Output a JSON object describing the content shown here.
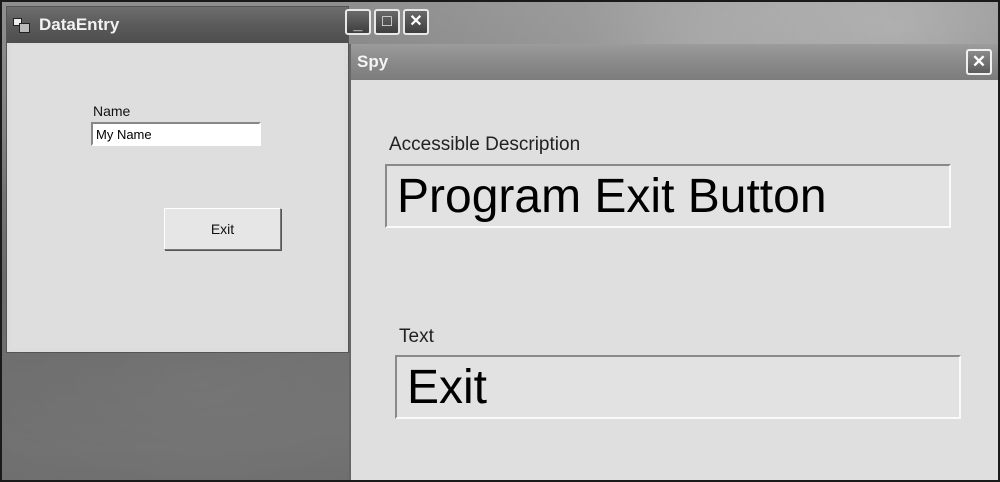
{
  "desktop": {},
  "dataentry_window": {
    "title": "DataEntry",
    "controls": {
      "minimize": "_",
      "maximize": "□",
      "close": "✕"
    },
    "name_label": "Name",
    "name_value": "My Name",
    "exit_label": "Exit"
  },
  "spy_window": {
    "title": "Spy",
    "close": "✕",
    "accessible_description_label": "Accessible Description",
    "accessible_description_value": "Program Exit Button",
    "text_label": "Text",
    "text_value": "Exit"
  }
}
